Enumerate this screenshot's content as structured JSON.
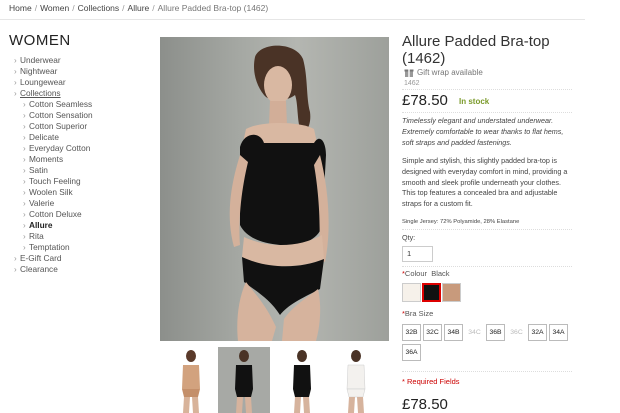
{
  "breadcrumb": {
    "items": [
      "Home",
      "Women",
      "Collections",
      "Allure"
    ],
    "current": "Allure Padded Bra-top (1462)",
    "separator": "/"
  },
  "sidebar": {
    "title": "WOMEN",
    "items": [
      {
        "label": "Underwear"
      },
      {
        "label": "Nightwear"
      },
      {
        "label": "Loungewear"
      },
      {
        "label": "Collections"
      },
      {
        "label": "Cotton Seamless"
      },
      {
        "label": "Cotton Sensation"
      },
      {
        "label": "Cotton Superior"
      },
      {
        "label": "Delicate"
      },
      {
        "label": "Everyday Cotton"
      },
      {
        "label": "Moments"
      },
      {
        "label": "Satin"
      },
      {
        "label": "Touch Feeling"
      },
      {
        "label": "Woolen Silk"
      },
      {
        "label": "Valerie"
      },
      {
        "label": "Cotton Deluxe"
      },
      {
        "label": "Allure"
      },
      {
        "label": "Rita"
      },
      {
        "label": "Temptation"
      },
      {
        "label": "E-Gift Card"
      },
      {
        "label": "Clearance"
      }
    ]
  },
  "product": {
    "title": "Allure Padded Bra-top (1462)",
    "gift_wrap": "Gift wrap available",
    "sku": "1462",
    "price": "£78.50",
    "stock": "In stock",
    "description_italic": "Timelessly elegant and understated underwear. Extremely comfortable to wear thanks to flat hems, soft straps and padded fastenings.",
    "description": "Simple and stylish, this slightly padded bra-top is designed with everyday comfort in mind, providing a smooth and sleek profile underneath your clothes. This top features a concealed bra and adjustable straps for a custom fit.",
    "material": "Single Jersey: 72% Polyamide, 28% Elastane",
    "qty_label": "Qty:",
    "qty_value": "1",
    "colour_label": "Colour",
    "colour_selected": "Black",
    "colours": [
      "#f6f1ea",
      "#111111",
      "#c89a7c"
    ],
    "size_label": "Bra Size",
    "sizes": [
      {
        "label": "32B",
        "available": true
      },
      {
        "label": "32C",
        "available": true
      },
      {
        "label": "34B",
        "available": true
      },
      {
        "label": "34C",
        "available": false
      },
      {
        "label": "36B",
        "available": true
      },
      {
        "label": "36C",
        "available": false
      },
      {
        "label": "32A",
        "available": true
      },
      {
        "label": "34A",
        "available": true
      },
      {
        "label": "36A",
        "available": true
      }
    ],
    "required_note": "* Required Fields",
    "price_bottom": "£78.50"
  },
  "colors": {
    "in_stock": "#7a9a2a",
    "required": "#cc0000",
    "selected_swatch_border": "#dd0000"
  }
}
